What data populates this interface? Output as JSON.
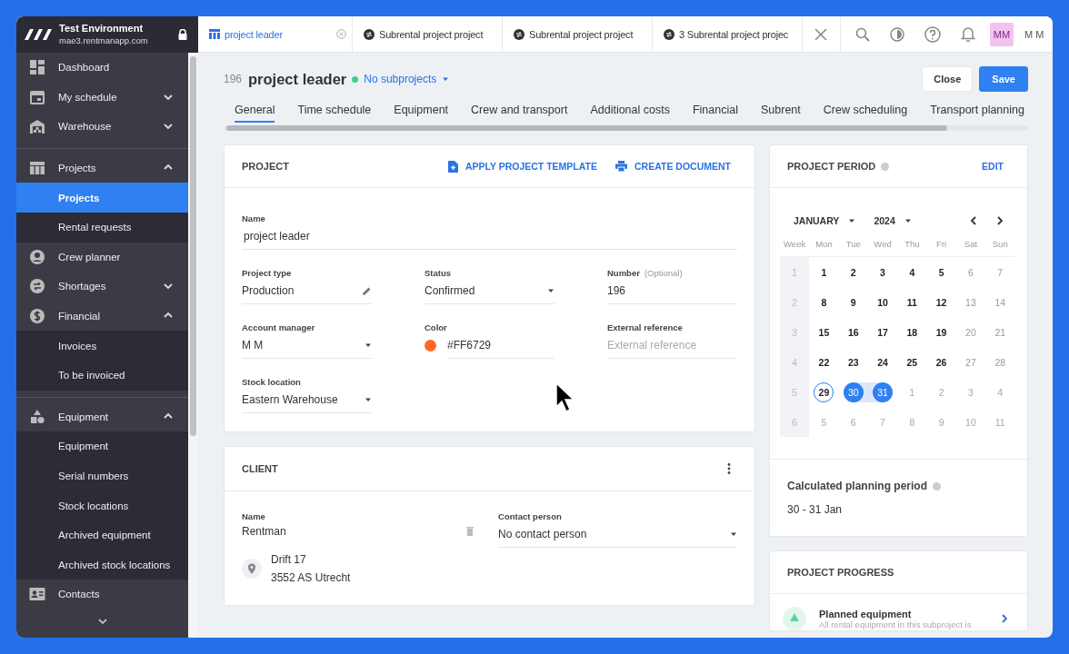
{
  "app": {
    "environment": "Test Environment",
    "domain": "mae3.rentmanapp.com"
  },
  "sidebar": {
    "groups": [
      [
        {
          "label": "Dashboard",
          "kind": "link"
        },
        {
          "label": "My schedule",
          "kind": "group",
          "expanded": false
        },
        {
          "label": "Warehouse",
          "kind": "group",
          "expanded": false
        }
      ],
      [
        {
          "label": "Projects",
          "kind": "group",
          "expanded": true,
          "children": [
            {
              "label": "Projects",
              "selected": true
            },
            {
              "label": "Rental requests",
              "selected": false
            }
          ]
        },
        {
          "label": "Crew planner",
          "kind": "link"
        },
        {
          "label": "Shortages",
          "kind": "group",
          "expanded": false
        },
        {
          "label": "Financial",
          "kind": "group",
          "expanded": true,
          "children": [
            {
              "label": "Invoices",
              "selected": false
            },
            {
              "label": "To be invoiced",
              "selected": false
            }
          ]
        }
      ],
      [
        {
          "label": "Equipment",
          "kind": "group",
          "expanded": true,
          "children": [
            {
              "label": "Equipment",
              "selected": false
            },
            {
              "label": "Serial numbers",
              "selected": false
            },
            {
              "label": "Stock locations",
              "selected": false
            },
            {
              "label": "Archived equipment",
              "selected": false
            },
            {
              "label": "Archived stock locations",
              "selected": false
            }
          ]
        },
        {
          "label": "Contacts",
          "kind": "link"
        }
      ]
    ]
  },
  "open_tabs": [
    {
      "label": "project leader",
      "selected": true
    },
    {
      "label": "Subrental project project",
      "selected": false
    },
    {
      "label": "Subrental project project",
      "selected": false
    },
    {
      "label": "3 Subrental project projec",
      "selected": false
    }
  ],
  "user": {
    "initials": "MM",
    "name": "M M"
  },
  "project": {
    "number": "196",
    "name": "project leader",
    "subprojects": "No subprojects",
    "buttons": [
      {
        "label": "Close",
        "kind": "secondary"
      },
      {
        "label": "Save",
        "kind": "primary"
      }
    ]
  },
  "section_tabs": [
    {
      "label": "General",
      "selected": true
    },
    {
      "label": "Time schedule",
      "selected": false
    },
    {
      "label": "Equipment",
      "selected": false
    },
    {
      "label": "Crew and transport",
      "selected": false
    },
    {
      "label": "Additional costs",
      "selected": false
    },
    {
      "label": "Financial",
      "selected": false
    },
    {
      "label": "Subrent",
      "selected": false
    },
    {
      "label": "Crew scheduling",
      "selected": false
    },
    {
      "label": "Transport planning",
      "selected": false
    }
  ],
  "project_card": {
    "title": "PROJECT",
    "actions": [
      {
        "label": "APPLY PROJECT TEMPLATE",
        "kind": "template"
      },
      {
        "label": "CREATE DOCUMENT",
        "kind": "print"
      }
    ],
    "rows": [
      [
        {
          "label": "Name",
          "kind": "text",
          "value": "project leader"
        }
      ],
      [
        {
          "label": "Project type",
          "kind": "edit",
          "value": "Production"
        },
        {
          "label": "Status",
          "kind": "select",
          "value": "Confirmed"
        },
        {
          "label": "Number",
          "hint": "(Optional)",
          "kind": "text",
          "value": "196"
        }
      ],
      [
        {
          "label": "Account manager",
          "kind": "select",
          "value": "M M"
        },
        {
          "label": "Color",
          "kind": "color",
          "value": "#FF6729"
        },
        {
          "label": "External reference",
          "kind": "text",
          "placeholder": "External reference"
        }
      ],
      [
        {
          "label": "Stock location",
          "kind": "select",
          "value": "Eastern Warehouse"
        }
      ]
    ]
  },
  "client_card": {
    "title": "CLIENT",
    "name_label": "Name",
    "name": "Rentman",
    "contact_label": "Contact person",
    "contact": "No contact person",
    "address": [
      "Drift 17",
      "3552 AS Utrecht"
    ]
  },
  "period_card": {
    "title": "PROJECT PERIOD",
    "action": "EDIT",
    "month": "JANUARY",
    "year": "2024",
    "weekdays": [
      "Week",
      "Mon",
      "Tue",
      "Wed",
      "Thu",
      "Fri",
      "Sat",
      "Sun"
    ],
    "weeks": [
      {
        "number": "1",
        "days": [
          {
            "label": "1",
            "kind": "weekday",
            "selected": false,
            "today": false
          },
          {
            "label": "2",
            "kind": "weekday",
            "selected": false,
            "today": false
          },
          {
            "label": "3",
            "kind": "weekday",
            "selected": false,
            "today": false
          },
          {
            "label": "4",
            "kind": "weekday",
            "selected": false,
            "today": false
          },
          {
            "label": "5",
            "kind": "weekday",
            "selected": false,
            "today": false
          },
          {
            "label": "6",
            "kind": "weekend",
            "selected": false,
            "today": false
          },
          {
            "label": "7",
            "kind": "weekend",
            "selected": false,
            "today": false
          }
        ]
      },
      {
        "number": "2",
        "days": [
          {
            "label": "8",
            "kind": "weekday",
            "selected": false,
            "today": false
          },
          {
            "label": "9",
            "kind": "weekday",
            "selected": false,
            "today": false
          },
          {
            "label": "10",
            "kind": "weekday",
            "selected": false,
            "today": false
          },
          {
            "label": "11",
            "kind": "weekday",
            "selected": false,
            "today": false
          },
          {
            "label": "12",
            "kind": "weekday",
            "selected": false,
            "today": false
          },
          {
            "label": "13",
            "kind": "weekend",
            "selected": false,
            "today": false
          },
          {
            "label": "14",
            "kind": "weekend",
            "selected": false,
            "today": false
          }
        ]
      },
      {
        "number": "3",
        "days": [
          {
            "label": "15",
            "kind": "weekday",
            "selected": false,
            "today": false
          },
          {
            "label": "16",
            "kind": "weekday",
            "selected": false,
            "today": false
          },
          {
            "label": "17",
            "kind": "weekday",
            "selected": false,
            "today": false
          },
          {
            "label": "18",
            "kind": "weekday",
            "selected": false,
            "today": false
          },
          {
            "label": "19",
            "kind": "weekday",
            "selected": false,
            "today": false
          },
          {
            "label": "20",
            "kind": "weekend",
            "selected": false,
            "today": false
          },
          {
            "label": "21",
            "kind": "weekend",
            "selected": false,
            "today": false
          }
        ]
      },
      {
        "number": "4",
        "days": [
          {
            "label": "22",
            "kind": "weekday",
            "selected": false,
            "today": false
          },
          {
            "label": "23",
            "kind": "weekday",
            "selected": false,
            "today": false
          },
          {
            "label": "24",
            "kind": "weekday",
            "selected": false,
            "today": false
          },
          {
            "label": "25",
            "kind": "weekday",
            "selected": false,
            "today": false
          },
          {
            "label": "26",
            "kind": "weekday",
            "selected": false,
            "today": false
          },
          {
            "label": "27",
            "kind": "weekend",
            "selected": false,
            "today": false
          },
          {
            "label": "28",
            "kind": "weekend",
            "selected": false,
            "today": false
          }
        ]
      },
      {
        "number": "5",
        "days": [
          {
            "label": "29",
            "kind": "weekday",
            "selected": false,
            "today": true
          },
          {
            "label": "30",
            "kind": "weekday",
            "selected": true,
            "today": false
          },
          {
            "label": "31",
            "kind": "weekday",
            "selected": true,
            "today": false
          },
          {
            "label": "1",
            "kind": "outside",
            "selected": false,
            "today": false
          },
          {
            "label": "2",
            "kind": "outside",
            "selected": false,
            "today": false
          },
          {
            "label": "3",
            "kind": "outside",
            "selected": false,
            "today": false
          },
          {
            "label": "4",
            "kind": "outside",
            "selected": false,
            "today": false
          }
        ]
      },
      {
        "number": "6",
        "days": [
          {
            "label": "5",
            "kind": "outside",
            "selected": false,
            "today": false
          },
          {
            "label": "6",
            "kind": "outside",
            "selected": false,
            "today": false
          },
          {
            "label": "7",
            "kind": "outside",
            "selected": false,
            "today": false
          },
          {
            "label": "8",
            "kind": "outside",
            "selected": false,
            "today": false
          },
          {
            "label": "9",
            "kind": "outside",
            "selected": false,
            "today": false
          },
          {
            "label": "10",
            "kind": "outside",
            "selected": false,
            "today": false
          },
          {
            "label": "11",
            "kind": "outside",
            "selected": false,
            "today": false
          }
        ]
      }
    ],
    "planning_label": "Calculated planning period",
    "planning_value": "30 - 31 Jan"
  },
  "progress_card": {
    "title": "PROJECT PROGRESS",
    "items": [
      {
        "title": "Planned equipment",
        "description": "All rental equipment in this subproject is"
      }
    ]
  }
}
